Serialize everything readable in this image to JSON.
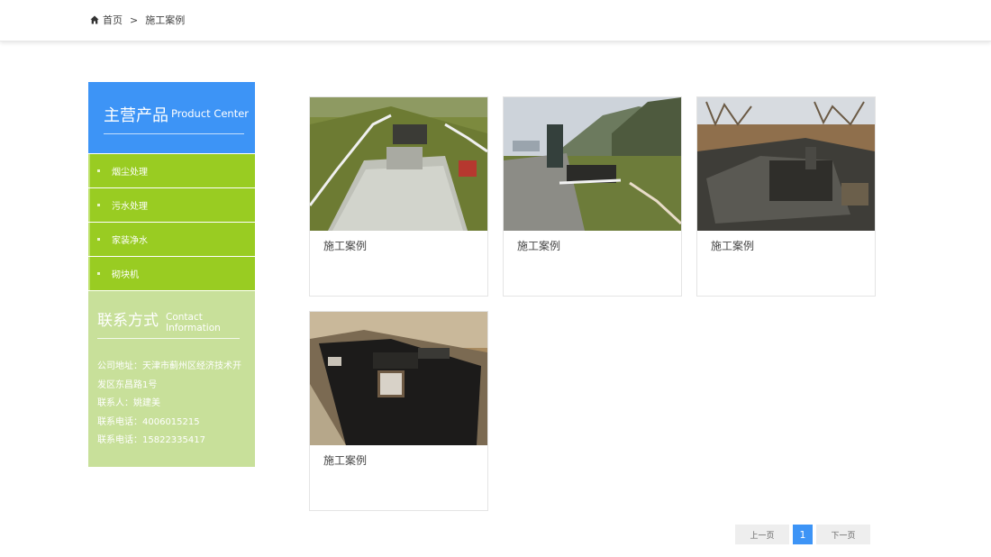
{
  "breadcrumb": {
    "home": "首页",
    "sep": ">",
    "current": "施工案例"
  },
  "sidebar": {
    "title_cn": "主营产品",
    "title_en": "Product Center",
    "items": [
      {
        "label": "烟尘处理"
      },
      {
        "label": "污水处理"
      },
      {
        "label": "家装净水"
      },
      {
        "label": "砌块机"
      }
    ]
  },
  "contact": {
    "title_cn": "联系方式",
    "title_en": "Contact Information",
    "lines": [
      "公司地址：天津市蓟州区经济技术开",
      "发区东昌路1号",
      "联系人：姚建美",
      "联系电话：4006015215",
      "联系电话：15822335417"
    ]
  },
  "cards": [
    {
      "caption": "施工案例",
      "image": "construction-site-photo-1"
    },
    {
      "caption": "施工案例",
      "image": "construction-site-photo-2"
    },
    {
      "caption": "施工案例",
      "image": "construction-site-photo-3"
    },
    {
      "caption": "施工案例",
      "image": "construction-site-photo-4"
    }
  ],
  "pagination": {
    "prev": "上一页",
    "current": "1",
    "next": "下一页"
  },
  "colors": {
    "accent_blue": "#3d94f6",
    "sidebar_green": "#99cc22",
    "contact_green": "#c8e09a"
  }
}
